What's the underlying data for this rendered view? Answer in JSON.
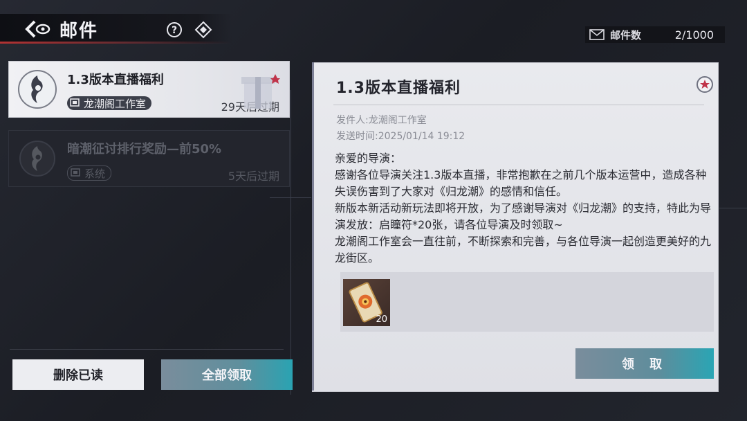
{
  "header": {
    "title": "邮件",
    "back_icon": "back-arrow-icon",
    "help_icon": "question-circle-icon",
    "filter_icon": "diamond-icon"
  },
  "mail_count": {
    "label": "邮件数",
    "value": "2/1000"
  },
  "mail_list": [
    {
      "title": "1.3版本直播福利",
      "sender": "龙潮阁工作室",
      "expire": "29天后过期",
      "selected": true
    },
    {
      "title": "暗潮征讨排行奖励—前50%",
      "sender": "系统",
      "expire": "5天后过期",
      "selected": false
    }
  ],
  "buttons": {
    "delete_read": "删除已读",
    "claim_all": "全部领取",
    "claim": "领 取"
  },
  "detail": {
    "title": "1.3版本直播福利",
    "sender_line": "发件人:龙潮阁工作室",
    "time_line": "发送时间:2025/01/14 19:12",
    "body": [
      "亲爱的导演：",
      "感谢各位导演关注1.3版本直播，非常抱歉在之前几个版本运营中，造成各种失误伤害到了大家对《归龙潮》的感情和信任。",
      "新版本新活动新玩法即将开放，为了感谢导演对《归龙潮》的支持，特此为导演发放：启瞳符*20张，请各位导演及时领取~",
      "龙潮阁工作室会一直往前，不断探索和完善，与各位导演一起创造更美好的九龙街区。"
    ],
    "reward": {
      "icon": "eye-talisman-icon",
      "quantity": "20"
    }
  },
  "colors": {
    "accent_red": "#b23232",
    "accent_teal": "#2aa3b2",
    "panel_bg": "#e9eaee"
  }
}
